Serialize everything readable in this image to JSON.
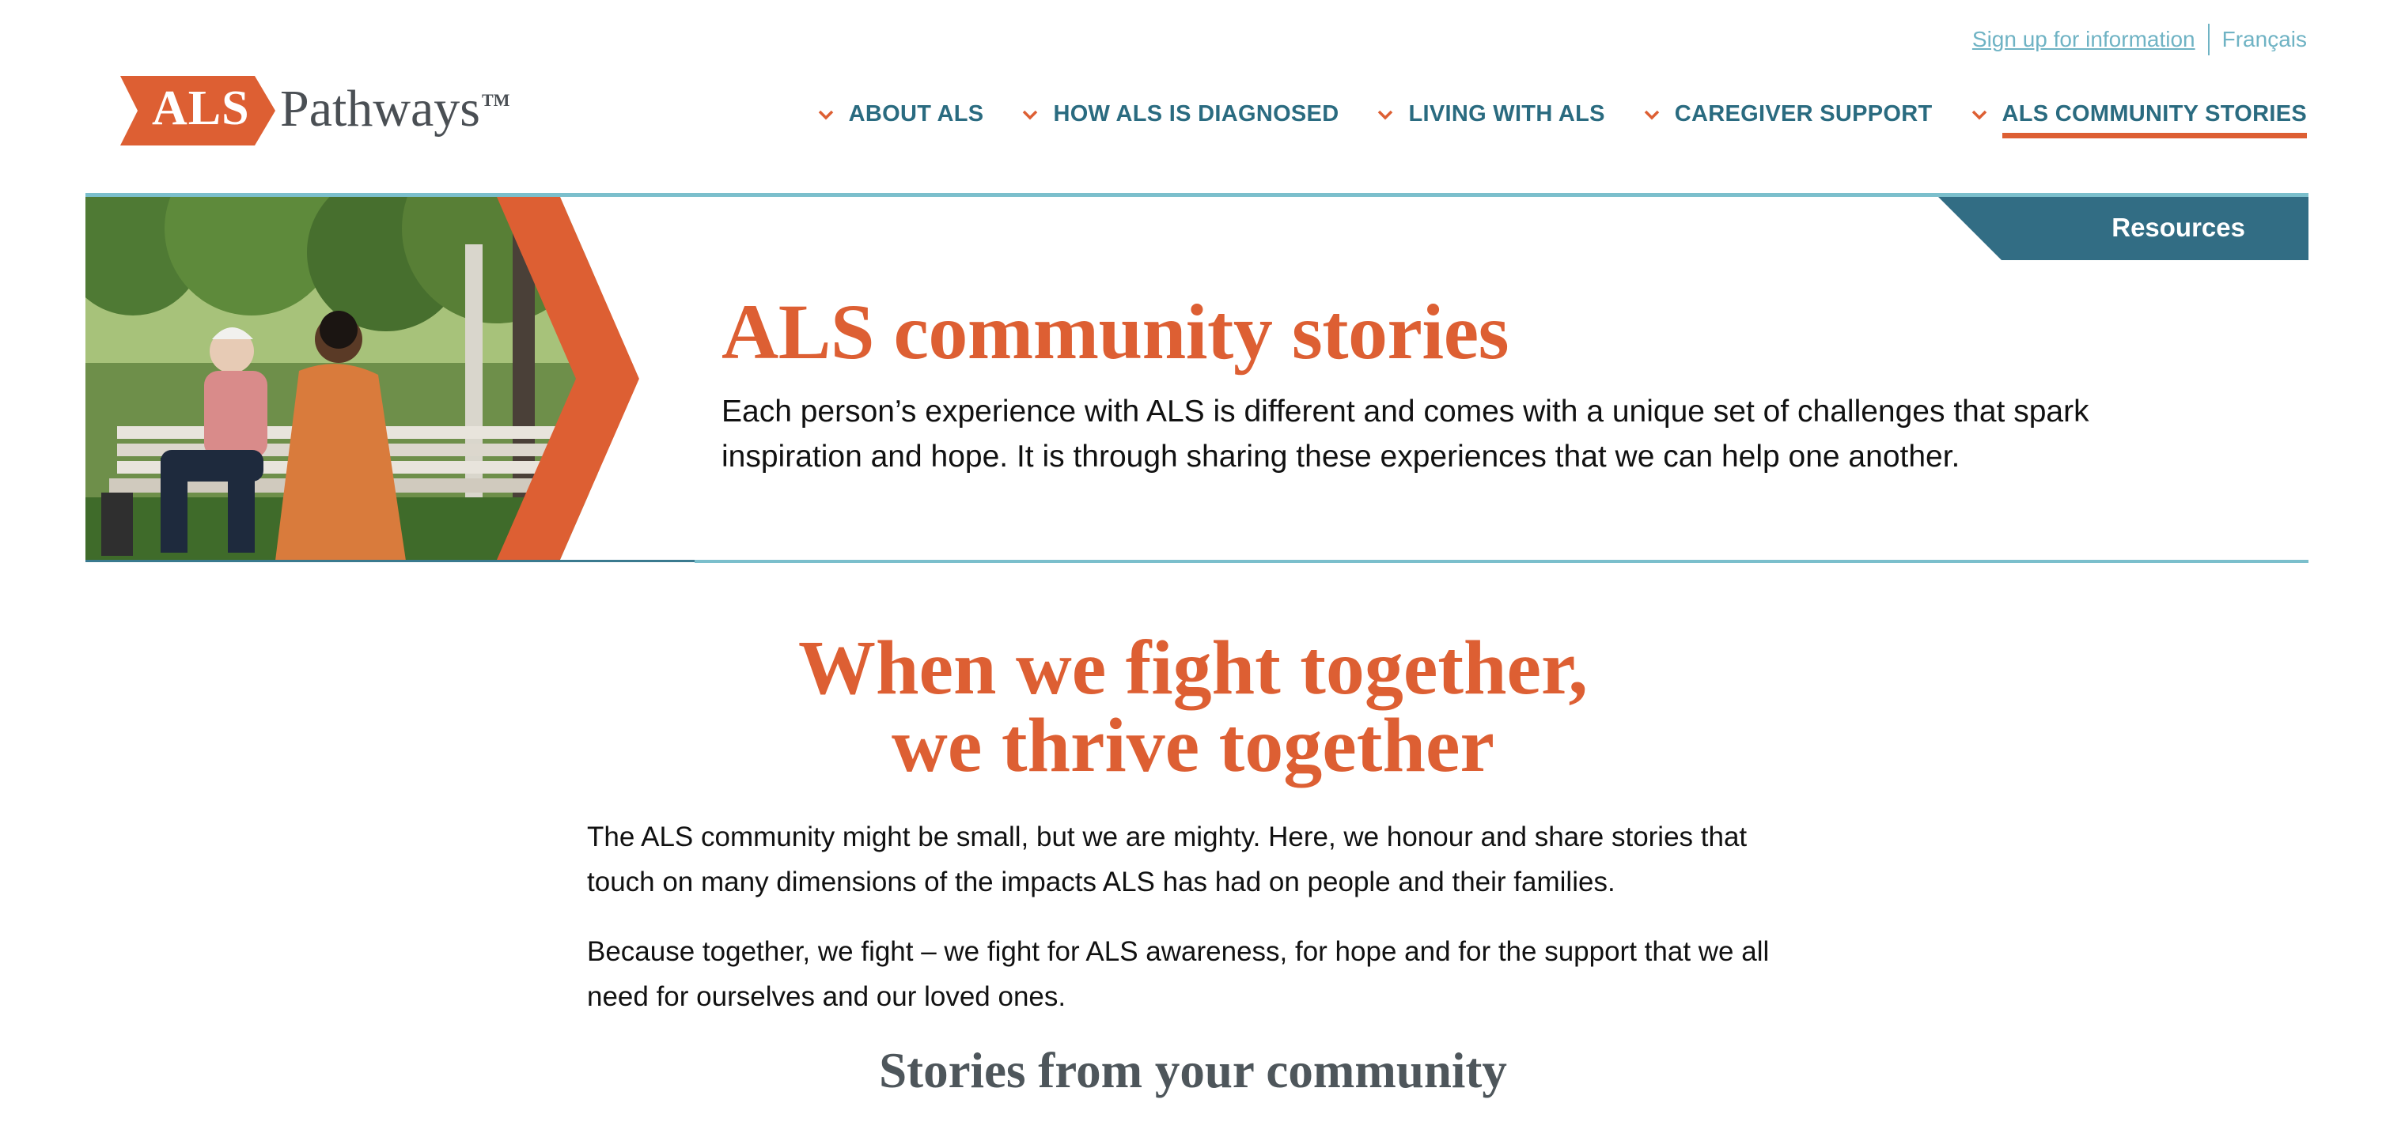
{
  "utility": {
    "signup_label": "Sign up for information",
    "language_label": "Français"
  },
  "logo": {
    "badge_text": "ALS",
    "wordmark": "Pathways",
    "trademark": "TM"
  },
  "nav": {
    "items": [
      {
        "label": "ABOUT ALS",
        "icon": "chevron-down-icon"
      },
      {
        "label": "HOW ALS IS DIAGNOSED",
        "icon": "chevron-down-icon"
      },
      {
        "label": "LIVING WITH ALS",
        "icon": "chevron-down-icon"
      },
      {
        "label": "CAREGIVER SUPPORT",
        "icon": "chevron-down-icon"
      },
      {
        "label": "ALS COMMUNITY STORIES",
        "icon": "chevron-down-icon",
        "active": true
      }
    ]
  },
  "hero": {
    "resources_label": "Resources",
    "title": "ALS community stories",
    "description": "Each person’s experience with ALS is different and comes with a unique set of challenges that spark inspiration and hope. It is through sharing these experiences that we can help one another."
  },
  "main": {
    "heading_line1": "When we fight together,",
    "heading_line2": "we thrive together",
    "paragraph1": "The ALS community might be small, but we are mighty. Here, we honour and share stories that touch on many dimensions of the impacts ALS has had on people and their families.",
    "paragraph2": "Because together, we fight – we fight for ALS awareness, for hope and for the support that we all need for ourselves and our loved ones.",
    "subheading": "Stories from your community"
  },
  "colors": {
    "accent_orange": "#dd5f33",
    "teal_dark": "#2a6b80",
    "teal_light": "#7bbfcc",
    "resources_bg": "#326d84"
  }
}
